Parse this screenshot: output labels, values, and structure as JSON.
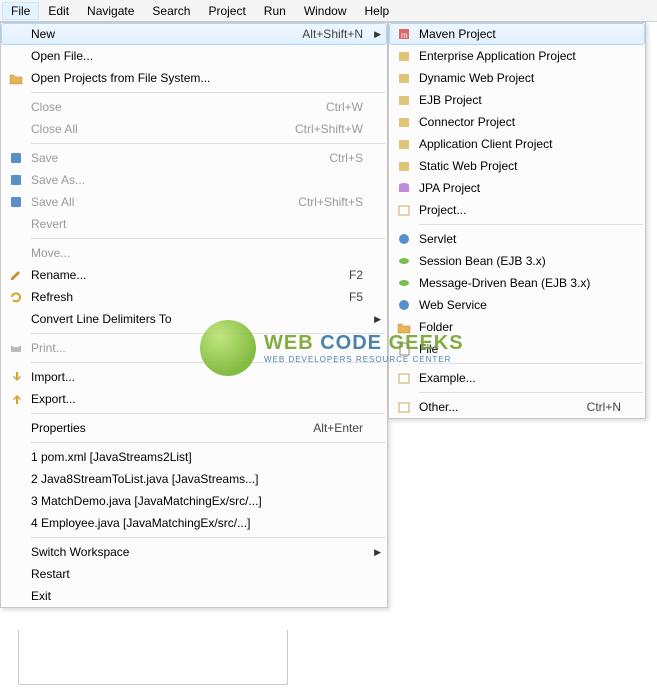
{
  "menubar": [
    "File",
    "Edit",
    "Navigate",
    "Search",
    "Project",
    "Run",
    "Window",
    "Help"
  ],
  "fileMenu": [
    {
      "label": "New",
      "shortcut": "Alt+Shift+N",
      "arrow": true,
      "highlight": true
    },
    {
      "label": "Open File..."
    },
    {
      "label": "Open Projects from File System...",
      "icon": "open-folder-icon"
    },
    {
      "sep": true
    },
    {
      "label": "Close",
      "shortcut": "Ctrl+W",
      "disabled": true
    },
    {
      "label": "Close All",
      "shortcut": "Ctrl+Shift+W",
      "disabled": true
    },
    {
      "sep": true
    },
    {
      "label": "Save",
      "shortcut": "Ctrl+S",
      "disabled": true,
      "icon": "save-icon"
    },
    {
      "label": "Save As...",
      "disabled": true,
      "icon": "save-as-icon"
    },
    {
      "label": "Save All",
      "shortcut": "Ctrl+Shift+S",
      "disabled": true,
      "icon": "save-all-icon"
    },
    {
      "label": "Revert",
      "disabled": true
    },
    {
      "sep": true
    },
    {
      "label": "Move...",
      "disabled": true
    },
    {
      "label": "Rename...",
      "shortcut": "F2",
      "icon": "rename-icon"
    },
    {
      "label": "Refresh",
      "shortcut": "F5",
      "icon": "refresh-icon"
    },
    {
      "label": "Convert Line Delimiters To",
      "arrow": true
    },
    {
      "sep": true
    },
    {
      "label": "Print...",
      "disabled": true,
      "icon": "print-icon"
    },
    {
      "sep": true
    },
    {
      "label": "Import...",
      "icon": "import-icon"
    },
    {
      "label": "Export...",
      "icon": "export-icon"
    },
    {
      "sep": true
    },
    {
      "label": "Properties",
      "shortcut": "Alt+Enter"
    },
    {
      "sep": true
    },
    {
      "label": "1 pom.xml  [JavaStreams2List]"
    },
    {
      "label": "2 Java8StreamToList.java  [JavaStreams...]"
    },
    {
      "label": "3 MatchDemo.java  [JavaMatchingEx/src/...]"
    },
    {
      "label": "4 Employee.java  [JavaMatchingEx/src/...]"
    },
    {
      "sep": true
    },
    {
      "label": "Switch Workspace",
      "arrow": true
    },
    {
      "label": "Restart"
    },
    {
      "label": "Exit"
    }
  ],
  "newSubmenu": [
    {
      "label": "Maven Project",
      "icon": "maven-icon",
      "highlight": true
    },
    {
      "label": "Enterprise Application Project",
      "icon": "ear-icon"
    },
    {
      "label": "Dynamic Web Project",
      "icon": "dynamic-web-icon"
    },
    {
      "label": "EJB Project",
      "icon": "ejb-icon"
    },
    {
      "label": "Connector Project",
      "icon": "connector-icon"
    },
    {
      "label": "Application Client Project",
      "icon": "appclient-icon"
    },
    {
      "label": "Static Web Project",
      "icon": "static-web-icon"
    },
    {
      "label": "JPA Project",
      "icon": "jpa-icon"
    },
    {
      "label": "Project...",
      "icon": "project-icon"
    },
    {
      "sep": true
    },
    {
      "label": "Servlet",
      "icon": "servlet-icon"
    },
    {
      "label": "Session Bean (EJB 3.x)",
      "icon": "session-bean-icon"
    },
    {
      "label": "Message-Driven Bean (EJB 3.x)",
      "icon": "mdb-icon"
    },
    {
      "label": "Web Service",
      "icon": "webservice-icon"
    },
    {
      "label": "Folder",
      "icon": "folder-icon"
    },
    {
      "label": "File",
      "icon": "file-icon"
    },
    {
      "sep": true
    },
    {
      "label": "Example...",
      "icon": "example-icon"
    },
    {
      "sep": true
    },
    {
      "label": "Other...",
      "shortcut": "Ctrl+N",
      "icon": "other-icon"
    }
  ],
  "watermark": {
    "title_a": "WEB ",
    "title_b": "CODE",
    "title_c": " GEEKS",
    "sub": "WEB DEVELOPERS RESOURCE CENTER"
  }
}
